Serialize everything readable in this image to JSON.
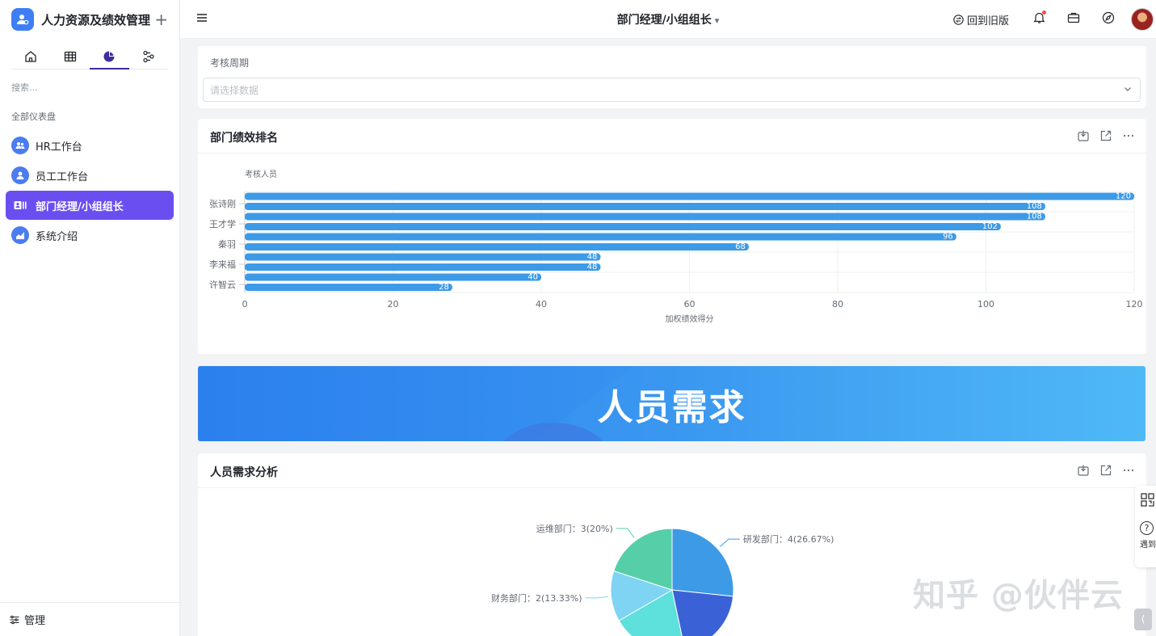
{
  "app": {
    "title": "人力资源及绩效管理",
    "plus": "+"
  },
  "sidebar": {
    "search_placeholder": "搜索...",
    "section_label": "全部仪表盘",
    "items": [
      {
        "label": "HR工作台"
      },
      {
        "label": "员工工作台"
      },
      {
        "label": "部门经理/小组组长"
      },
      {
        "label": "系统介绍"
      }
    ],
    "footer_label": "管理"
  },
  "topbar": {
    "title": "部门经理/小组组长",
    "old_version_label": "回到旧版"
  },
  "filter": {
    "label": "考核周期",
    "placeholder": "请选择数据"
  },
  "rank_card": {
    "title": "部门绩效排名"
  },
  "banner": {
    "text": "人员需求"
  },
  "pie_card": {
    "title": "人员需求分析"
  },
  "help_widget": {
    "text": "遇到问题"
  },
  "watermark": "知乎 @伙伴云",
  "colors": {
    "accent": "#6b4ef0",
    "bar": "#3d9ae6",
    "icon_blue": "#4b7cf0"
  },
  "chart_data": [
    {
      "type": "bar",
      "orientation": "horizontal",
      "ylabel": "考核人员",
      "xlabel": "加权绩效得分",
      "xlim": [
        0,
        120
      ],
      "xticks": [
        0,
        20,
        40,
        60,
        80,
        100,
        120
      ],
      "category_tick_labels": [
        "张诗刚",
        "王才学",
        "秦羽",
        "李来福",
        "许智云"
      ],
      "values": [
        120,
        108,
        108,
        102,
        96,
        68,
        48,
        48,
        40,
        28
      ],
      "grid": true
    },
    {
      "type": "pie",
      "slices": [
        {
          "label": "研发部门：4(26.67%)",
          "value": 4,
          "color": "#3d9ae6"
        },
        {
          "label": "",
          "value": 3,
          "color": "#3a62d6"
        },
        {
          "label": "",
          "value": 3,
          "color": "#5ee0dc"
        },
        {
          "label": "财务部门：2(13.33%)",
          "value": 2,
          "color": "#7fd3f3"
        },
        {
          "label": "运维部门：3(20%)",
          "value": 3,
          "color": "#56cfa8"
        }
      ]
    }
  ]
}
